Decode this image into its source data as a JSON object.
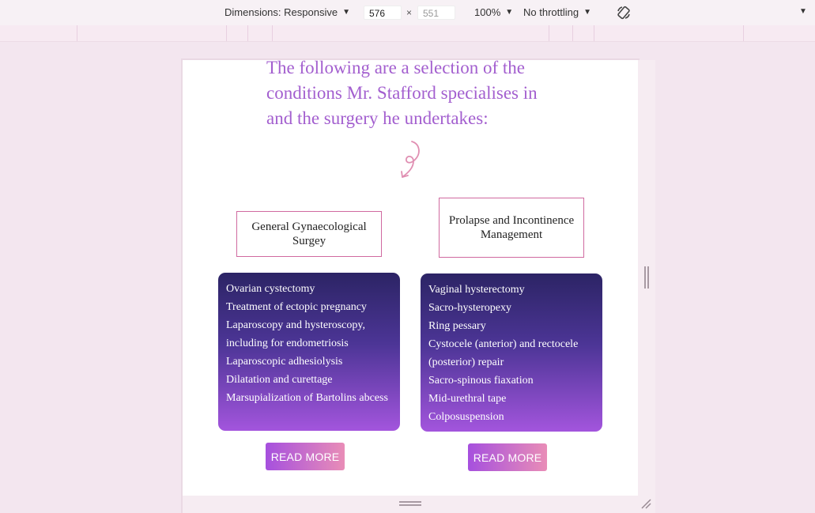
{
  "devtools": {
    "dimensions_label": "Dimensions: Responsive",
    "width_value": "576",
    "height_value": "551",
    "times_sign": "×",
    "zoom_label": "100%",
    "throttling_label": "No throttling"
  },
  "page": {
    "intro_text": "The following are a selection of the conditions Mr. Stafford specialises in and the surgery he undertakes:",
    "cards": [
      {
        "title": "General Gynaecological Surgey",
        "items": [
          "Ovarian cystectomy",
          "Treatment of ectopic pregnancy",
          "Laparoscopy and hysteroscopy, including for endometriosis",
          "Laparoscopic adhesiolysis",
          "Dilatation and curettage",
          "Marsupialization of Bartolins abcess"
        ],
        "button_label": "READ MORE"
      },
      {
        "title": "Prolapse and Incontinence Management",
        "items": [
          "Vaginal hysterectomy",
          "Sacro-hysteropexy",
          "Ring pessary",
          "Cystocele (anterior) and rectocele (posterior) repair",
          "Sacro-spinous fiaxation",
          "Mid-urethral tape",
          "Colposuspension"
        ],
        "button_label": "READ MORE"
      }
    ]
  },
  "colors": {
    "accent_purple": "#a35fcf",
    "card_gradient_top": "#2c2465",
    "card_gradient_bottom": "#a355dd",
    "border_pink": "#d06aa0",
    "button_gradient_start": "#a650de",
    "button_gradient_end": "#e98db7"
  },
  "icons": [
    "caret-down-icon",
    "rotate-icon",
    "swirl-arrow-icon",
    "resize-grip-icon"
  ]
}
